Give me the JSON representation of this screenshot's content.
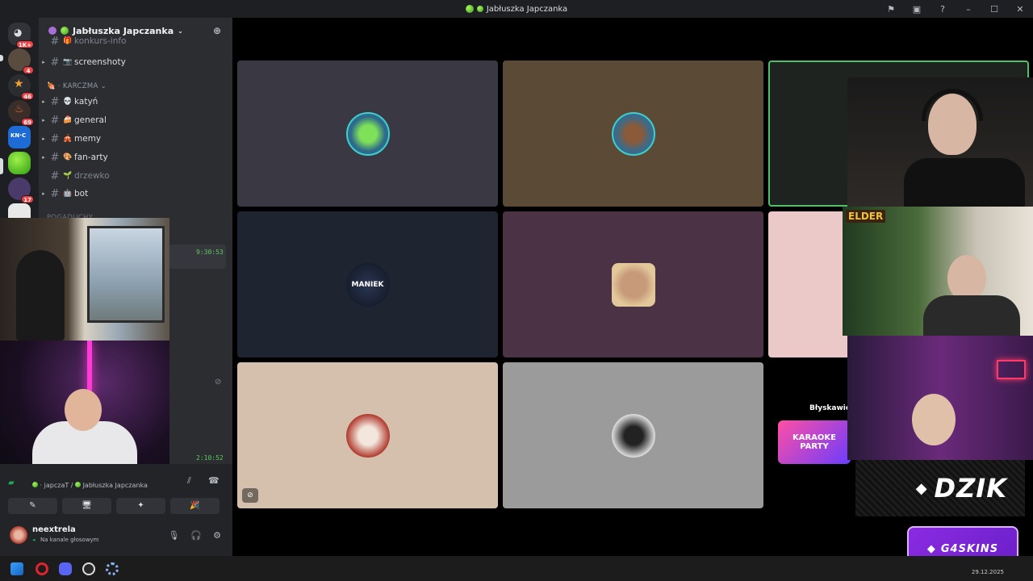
{
  "window": {
    "title": "Jabłuszka Japczanka",
    "controls": [
      "⚑",
      "▣",
      "?",
      "–",
      "☐",
      "✕"
    ]
  },
  "servers": [
    {
      "name": "discord-home",
      "badge": "1K+"
    },
    {
      "name": "server-2",
      "badge": "4"
    },
    {
      "name": "server-3",
      "badge": "46"
    },
    {
      "name": "server-4",
      "badge": "69"
    },
    {
      "name": "knockout",
      "badge": ""
    },
    {
      "name": "jabluszka",
      "badge": ""
    },
    {
      "name": "server-7",
      "badge": "17"
    },
    {
      "name": "server-8",
      "badge": ""
    }
  ],
  "guild": {
    "name": "Jabłuszka Japczanka",
    "partial_top": "konkurs-info",
    "channels_top": [
      {
        "name": "screenshoty",
        "emoji": "📷",
        "dim": false
      }
    ],
    "category": "KARCZMA",
    "channels": [
      {
        "name": "katyń",
        "emoji": "💀",
        "dim": false
      },
      {
        "name": "general",
        "emoji": "🍰",
        "dim": false
      },
      {
        "name": "memy",
        "emoji": "🎪",
        "dim": false
      },
      {
        "name": "fan-arty",
        "emoji": "🎨",
        "dim": false
      },
      {
        "name": "drzewko",
        "emoji": "🌱",
        "dim": true
      },
      {
        "name": "bot",
        "emoji": "🤖",
        "dim": false
      }
    ],
    "partial_bottom": "POGADUCHY"
  },
  "timers": {
    "a": "9:30:53",
    "b": "2:10:52"
  },
  "voice": {
    "location_user": "japczaT",
    "location_server": "Jabłuszka Japczanka",
    "buttons": [
      "✎",
      "🖥",
      "✦",
      "🎉"
    ]
  },
  "user": {
    "name": "neextrela",
    "status": "Na kanale głosowym"
  },
  "stage": {
    "name_tag": "Błyskawicz",
    "avatar_label": "MANIEK",
    "karaoke": "KARAOKE PARTY"
  },
  "overlays": {
    "dzik": "DZIK",
    "g4skins": "G4SKINS",
    "elder": "ELDER"
  },
  "taskbar_date": "29.12.2025",
  "colors": {
    "tile1": "#3a3842",
    "tile2": "#5b4a35",
    "tile3": "#1f2320",
    "tile4": "#1e2430",
    "tile5": "#4b3244",
    "tile6": "#ecc9c9",
    "tile7": "#d4c0ad",
    "tile8": "#9b9b9b",
    "tile9": "#000000"
  }
}
